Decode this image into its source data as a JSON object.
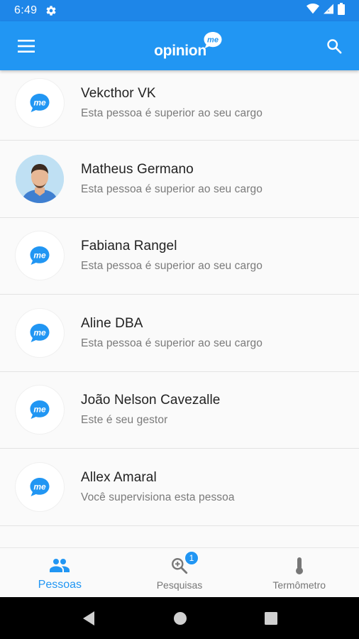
{
  "status_bar": {
    "time": "6:49"
  },
  "app_bar": {
    "logo_text": "opinion",
    "logo_badge": "me"
  },
  "people": [
    {
      "name": "Vekcthor VK",
      "subtitle": "Esta pessoa é superior ao seu cargo",
      "avatar": "me-logo"
    },
    {
      "name": "Matheus Germano",
      "subtitle": "Esta pessoa é superior ao seu cargo",
      "avatar": "photo"
    },
    {
      "name": "Fabiana Rangel",
      "subtitle": "Esta pessoa é superior ao seu cargo",
      "avatar": "me-logo"
    },
    {
      "name": "Aline DBA",
      "subtitle": "Esta pessoa é superior ao seu cargo",
      "avatar": "me-logo"
    },
    {
      "name": "João Nelson Cavezalle",
      "subtitle": "Este é seu gestor",
      "avatar": "me-logo"
    },
    {
      "name": "Allex Amaral",
      "subtitle": "Você supervisiona esta pessoa",
      "avatar": "me-logo"
    }
  ],
  "bottom_nav": {
    "items": [
      {
        "label": "Pessoas",
        "icon": "people-icon",
        "active": true
      },
      {
        "label": "Pesquisas",
        "icon": "search-plus-icon",
        "badge": "1"
      },
      {
        "label": "Termômetro",
        "icon": "thermometer-icon"
      }
    ]
  },
  "colors": {
    "primary": "#2196f3",
    "status_bar": "#1e86e8"
  }
}
